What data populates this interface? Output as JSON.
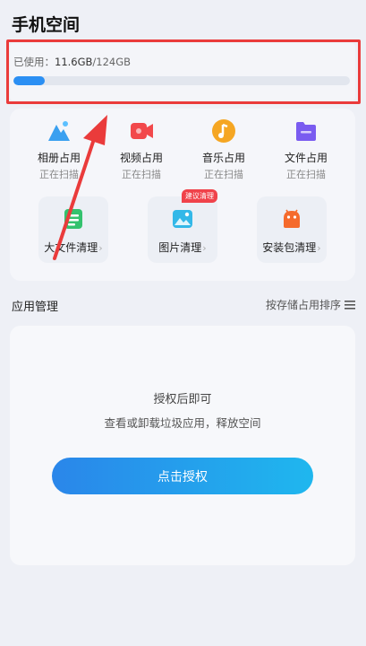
{
  "header": {
    "title": "手机空间"
  },
  "storage": {
    "label": "已使用：",
    "used": "11.6GB",
    "total": "/124GB",
    "used_fraction": 0.094,
    "bar_color": "#2b8ff3"
  },
  "categories": [
    {
      "label": "相册占用",
      "status": "正在扫描",
      "icon": "photo-album-icon",
      "color": "#3aa0f0"
    },
    {
      "label": "视频占用",
      "status": "正在扫描",
      "icon": "video-icon",
      "color": "#f2484b"
    },
    {
      "label": "音乐占用",
      "status": "正在扫描",
      "icon": "music-icon",
      "color": "#f5a623"
    },
    {
      "label": "文件占用",
      "status": "正在扫描",
      "icon": "folder-icon",
      "color": "#7a5cf0"
    }
  ],
  "tools": [
    {
      "label": "大文件清理",
      "icon": "large-file-icon",
      "color": "#34c26e"
    },
    {
      "label": "图片清理",
      "icon": "picture-icon",
      "color": "#33b8e8",
      "badge": "建议清理"
    },
    {
      "label": "安装包清理",
      "icon": "android-package-icon",
      "color": "#f56a2c"
    }
  ],
  "chevron": "›",
  "section": {
    "title": "应用管理",
    "sort_label": "按存储占用排序"
  },
  "auth": {
    "title": "授权后即可",
    "desc": "查看或卸载垃圾应用，释放空间",
    "button": "点击授权"
  },
  "accent": "#ea3b3b"
}
